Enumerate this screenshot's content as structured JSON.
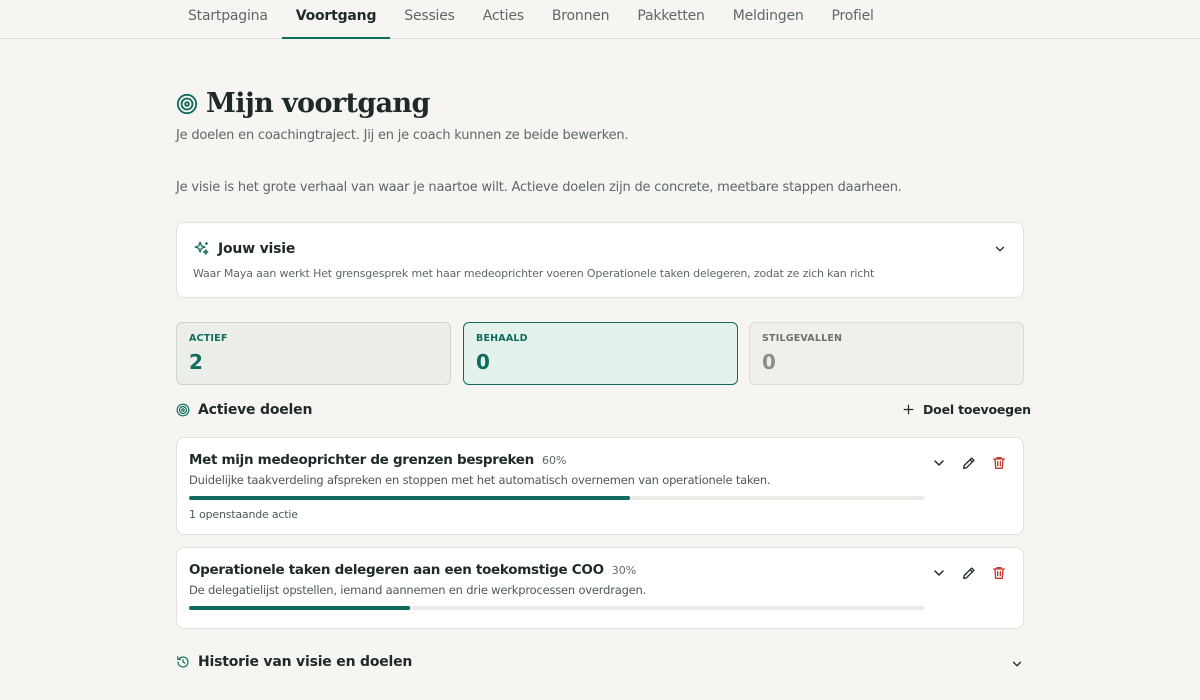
{
  "nav": {
    "tabs": [
      {
        "label": "Startpagina",
        "active": false
      },
      {
        "label": "Voortgang",
        "active": true
      },
      {
        "label": "Sessies",
        "active": false
      },
      {
        "label": "Acties",
        "active": false
      },
      {
        "label": "Bronnen",
        "active": false
      },
      {
        "label": "Pakketten",
        "active": false
      },
      {
        "label": "Meldingen",
        "active": false
      },
      {
        "label": "Profiel",
        "active": false
      }
    ]
  },
  "header": {
    "title": "Mijn voortgang",
    "subtitle": "Je doelen en coachingtraject. Jij en je coach kunnen ze beide bewerken.",
    "intro": "Je visie is het grote verhaal van waar je naartoe wilt. Actieve doelen zijn de concrete, meetbare stappen daarheen."
  },
  "vision": {
    "title": "Jouw visie",
    "text": "Waar Maya aan werkt Het grensgesprek met haar medeoprichter voeren Operationele taken delegeren, zodat ze zich kan richt"
  },
  "stats": {
    "active": {
      "label": "ACTIEF",
      "value": "2"
    },
    "achieved": {
      "label": "BEHAALD",
      "value": "0"
    },
    "stopped": {
      "label": "STILGEVALLEN",
      "value": "0"
    }
  },
  "goals_section": {
    "title": "Actieve doelen",
    "add_label": "Doel toevoegen"
  },
  "goals": [
    {
      "title": "Met mijn medeoprichter de grenzen bespreken",
      "percent_label": "60%",
      "progress": 0.6,
      "description": "Duidelijke taakverdeling afspreken en stoppen met het automatisch overnemen van operationele taken.",
      "open_actions": "1 openstaande actie"
    },
    {
      "title": "Operationele taken delegeren aan een toekomstige COO",
      "percent_label": "30%",
      "progress": 0.3,
      "description": "De delegatielijst opstellen, iemand aannemen en drie werkprocessen overdragen."
    }
  ],
  "history": {
    "title": "Historie van visie en doelen"
  },
  "colors": {
    "accent": "#0f6b5e",
    "danger": "#c0392b",
    "background": "#f6f5f1"
  }
}
